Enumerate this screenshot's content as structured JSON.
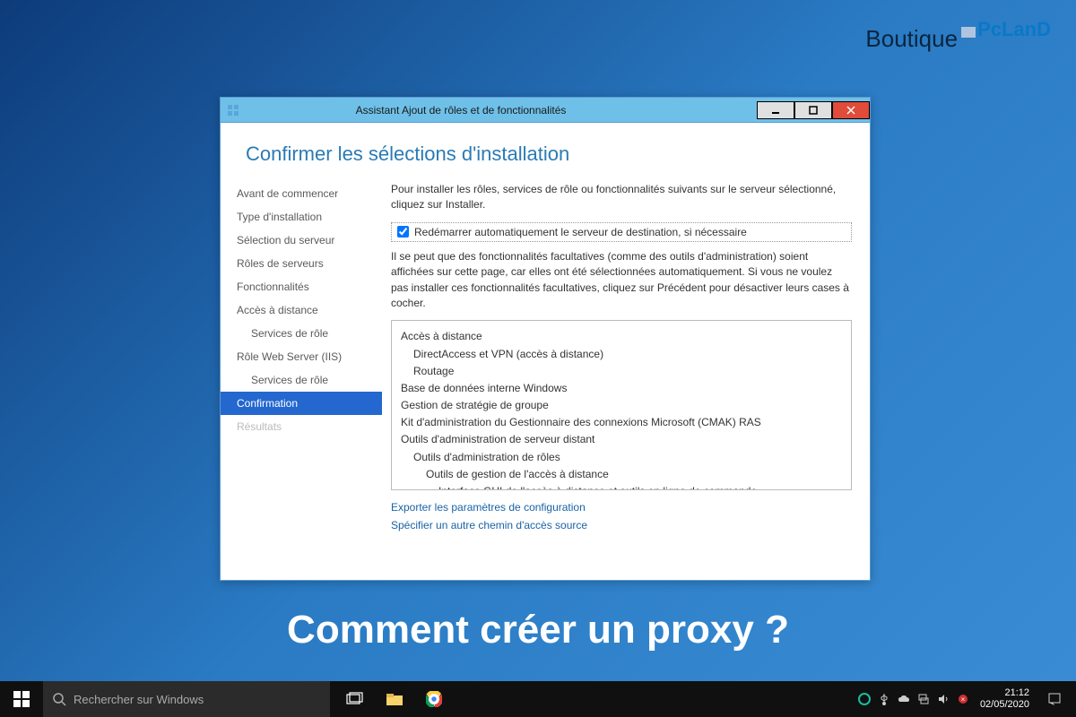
{
  "watermark": {
    "main": "Boutique",
    "sub": "PcLanD"
  },
  "window": {
    "title": "Assistant Ajout de rôles et de fonctionnalités",
    "page_title": "Confirmer les sélections d'installation"
  },
  "sidebar": {
    "items": [
      {
        "label": "Avant de commencer",
        "indent": false
      },
      {
        "label": "Type d'installation",
        "indent": false
      },
      {
        "label": "Sélection du serveur",
        "indent": false
      },
      {
        "label": "Rôles de serveurs",
        "indent": false
      },
      {
        "label": "Fonctionnalités",
        "indent": false
      },
      {
        "label": "Accès à distance",
        "indent": false
      },
      {
        "label": "Services de rôle",
        "indent": true
      },
      {
        "label": "Rôle Web Server (IIS)",
        "indent": false
      },
      {
        "label": "Services de rôle",
        "indent": true
      },
      {
        "label": "Confirmation",
        "indent": false,
        "selected": true
      },
      {
        "label": "Résultats",
        "indent": false,
        "disabled": true
      }
    ]
  },
  "content": {
    "intro": "Pour installer les rôles, services de rôle ou fonctionnalités suivants sur le serveur sélectionné, cliquez sur Installer.",
    "checkbox_label": "Redémarrer automatiquement le serveur de destination, si nécessaire",
    "checkbox_checked": true,
    "note": "Il se peut que des fonctionnalités facultatives (comme des outils d'administration) soient affichées sur cette page, car elles ont été sélectionnées automatiquement. Si vous ne voulez pas installer ces fonctionnalités facultatives, cliquez sur Précédent pour désactiver leurs cases à cocher.",
    "features": [
      {
        "label": "Accès à distance",
        "lvl": 0
      },
      {
        "label": "DirectAccess et VPN (accès à distance)",
        "lvl": 1
      },
      {
        "label": "Routage",
        "lvl": 1
      },
      {
        "label": "Base de données interne Windows",
        "lvl": 0
      },
      {
        "label": "Gestion de stratégie de groupe",
        "lvl": 0
      },
      {
        "label": "Kit d'administration du Gestionnaire des connexions Microsoft (CMAK) RAS",
        "lvl": 0
      },
      {
        "label": "Outils d'administration de serveur distant",
        "lvl": 0
      },
      {
        "label": "Outils d'administration de rôles",
        "lvl": 1
      },
      {
        "label": "Outils de gestion de l'accès à distance",
        "lvl": 2
      },
      {
        "label": "Interface GUI de l'accès à distance et outils en ligne de commande",
        "lvl": 3
      }
    ],
    "links": {
      "export": "Exporter les paramètres de configuration",
      "specify": "Spécifier un autre chemin d'accès source"
    }
  },
  "caption": "Comment créer un proxy ?",
  "taskbar": {
    "search_placeholder": "Rechercher sur Windows",
    "clock_time": "21:12",
    "clock_date": "02/05/2020"
  }
}
